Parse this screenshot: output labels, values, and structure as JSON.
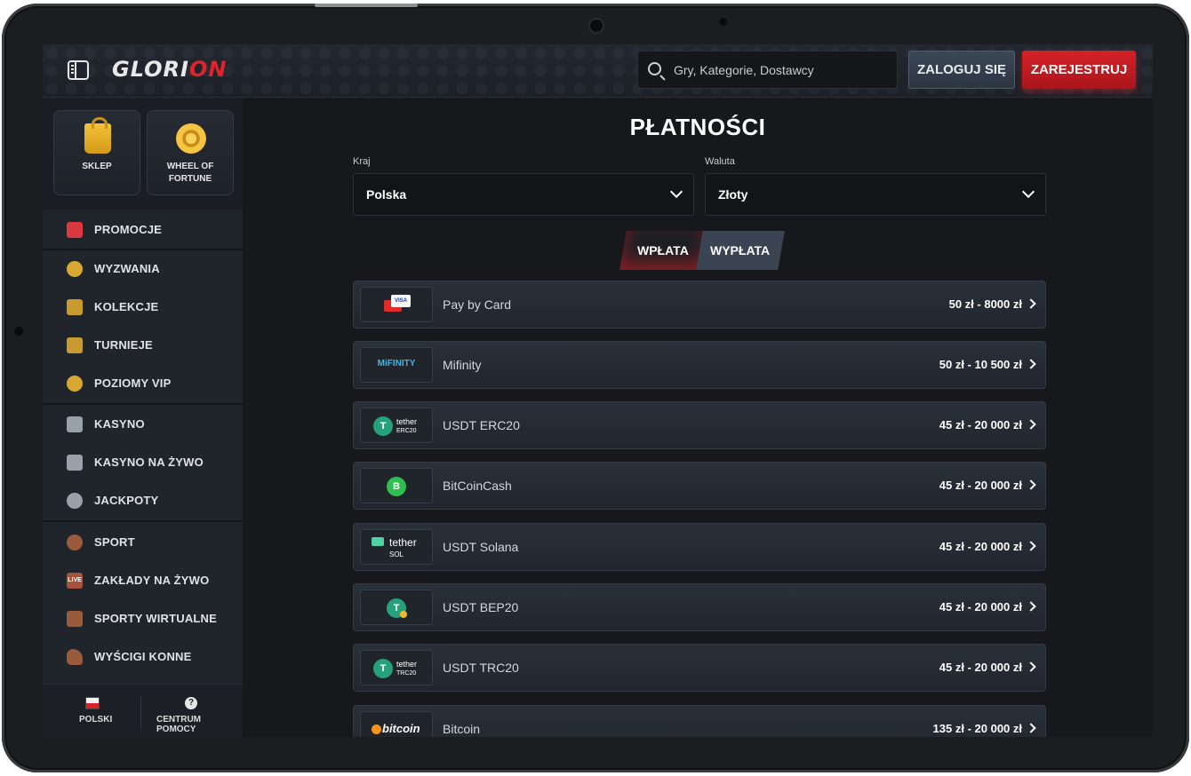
{
  "header": {
    "logo_main": "GLORI",
    "logo_accent": "ON",
    "search_placeholder": "Gry, Kategorie, Dostawcy",
    "login_label": "ZALOGUJ SIĘ",
    "register_label": "ZAREJESTRUJ"
  },
  "sidebar": {
    "tiles": [
      {
        "label": "SKLEP",
        "icon": "shopping-bag-icon"
      },
      {
        "label": "WHEEL OF FORTUNE",
        "icon": "wheel-icon"
      }
    ],
    "groups": [
      [
        {
          "label": "PROMOCJE",
          "icon": "gift-icon"
        }
      ],
      [
        {
          "label": "WYZWANIA",
          "icon": "medal-icon"
        },
        {
          "label": "KOLEKCJE",
          "icon": "cards-icon"
        },
        {
          "label": "TURNIEJE",
          "icon": "podium-icon"
        },
        {
          "label": "POZIOMY VIP",
          "icon": "diamond-icon"
        }
      ],
      [
        {
          "label": "KASYNO",
          "icon": "slot-machine-icon"
        },
        {
          "label": "KASYNO NA ŻYWO",
          "icon": "playing-card-icon"
        },
        {
          "label": "JACKPOTY",
          "icon": "clover-icon"
        }
      ],
      [
        {
          "label": "SPORT",
          "icon": "soccer-ball-icon"
        },
        {
          "label": "ZAKŁADY NA ŻYWO",
          "icon": "live-icon",
          "badge": "LIVE"
        },
        {
          "label": "SPORTY WIRTUALNE",
          "icon": "virtual-sports-icon"
        },
        {
          "label": "WYŚCIGI KONNE",
          "icon": "horse-icon"
        }
      ]
    ],
    "bottom": {
      "language_label": "POLSKI",
      "help_label": "CENTRUM POMOCY",
      "help_glyph": "?"
    }
  },
  "main": {
    "title": "PŁATNOŚCI",
    "country_label": "Kraj",
    "country_value": "Polska",
    "currency_label": "Waluta",
    "currency_value": "Złoty",
    "tabs": [
      {
        "label": "WPŁATA",
        "active": true
      },
      {
        "label": "WYPŁATA",
        "active": false
      }
    ],
    "methods": [
      {
        "name": "Pay by Card",
        "range": "50 zł - 8000 zł",
        "logo_text": "VISA"
      },
      {
        "name": "Mifinity",
        "range": "50 zł - 10 500 zł",
        "logo_text": "MiFINITY"
      },
      {
        "name": "USDT ERC20",
        "range": "45 zł - 20 000 zł",
        "logo_text": "tether",
        "logo_sub": "ERC20"
      },
      {
        "name": "BitCoinCash",
        "range": "45 zł - 20 000 zł",
        "logo_text": "B"
      },
      {
        "name": "USDT Solana",
        "range": "45 zł - 20 000 zł",
        "logo_text": "tether",
        "logo_sub": "SOL"
      },
      {
        "name": "USDT BEP20",
        "range": "45 zł - 20 000 zł",
        "logo_text": "T"
      },
      {
        "name": "USDT TRC20",
        "range": "45 zł - 20 000 zł",
        "logo_text": "tether",
        "logo_sub": "TRC20"
      },
      {
        "name": "Bitcoin",
        "range": "135 zł - 20 000 zł",
        "logo_text": "bitcoin"
      }
    ]
  },
  "colors": {
    "accent": "#d52128",
    "background": "#16181c",
    "sidebar": "#20242b"
  }
}
